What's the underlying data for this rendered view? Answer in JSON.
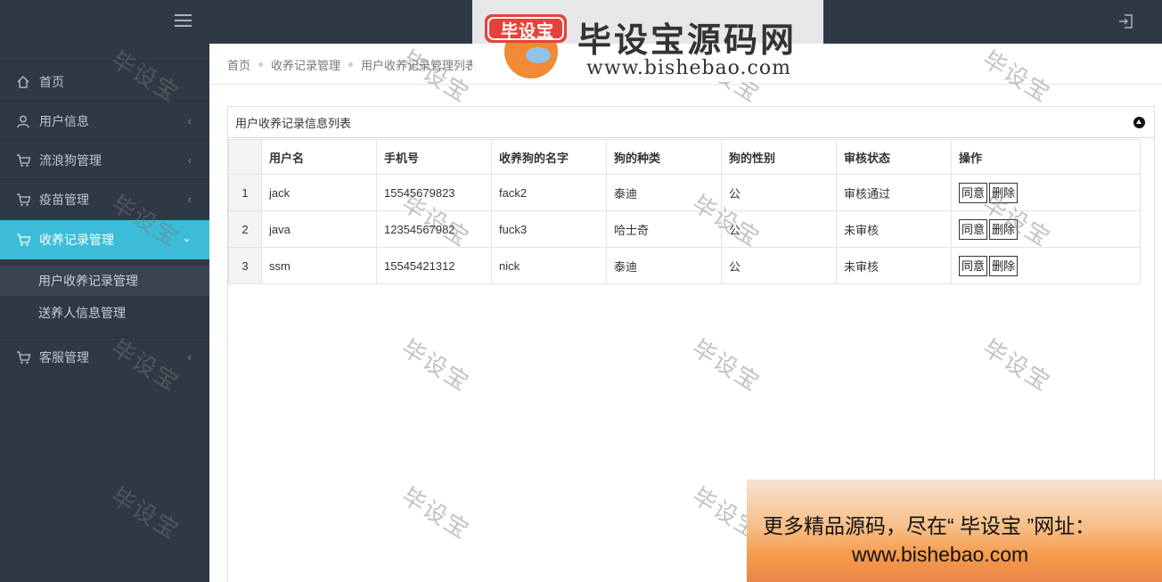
{
  "topbar": {
    "menu_icon": "hamburger-icon",
    "logout_icon": "logout-icon"
  },
  "sidebar": {
    "items": [
      {
        "label": "首页",
        "icon": "home-icon",
        "has_submenu": false
      },
      {
        "label": "用户信息",
        "icon": "user-icon",
        "has_submenu": true
      },
      {
        "label": "流浪狗管理",
        "icon": "cart-icon",
        "has_submenu": true
      },
      {
        "label": "疫苗管理",
        "icon": "cart-icon",
        "has_submenu": true
      },
      {
        "label": "收养记录管理",
        "icon": "cart-icon",
        "has_submenu": true,
        "expanded": true
      },
      {
        "label": "客服管理",
        "icon": "cart-icon",
        "has_submenu": true
      }
    ],
    "subitems": [
      {
        "label": "用户收养记录管理",
        "current": true
      },
      {
        "label": "送养人信息管理",
        "current": false
      }
    ],
    "active_color": "#3cbcd8"
  },
  "breadcrumb": {
    "items": [
      "首页",
      "收养记录管理",
      "用户收养记录管理列表"
    ]
  },
  "panel": {
    "title": "用户收养记录信息列表",
    "columns": [
      "用户名",
      "手机号",
      "收养狗的名字",
      "狗的种类",
      "狗的性别",
      "审核状态",
      "操作"
    ],
    "rows": [
      {
        "index": "1",
        "username": "jack",
        "phone": "15545679823",
        "dog_name": "fack2",
        "breed": "泰迪",
        "gender": "公",
        "status": "审核通过"
      },
      {
        "index": "2",
        "username": "java",
        "phone": "12354567982",
        "dog_name": "fuck3",
        "breed": "哈士奇",
        "gender": "公",
        "status": "未审核"
      },
      {
        "index": "3",
        "username": "ssm",
        "phone": "15545421312",
        "dog_name": "nick",
        "breed": "泰迪",
        "gender": "公",
        "status": "未审核"
      }
    ],
    "approve_label": "同意",
    "delete_label": "删除"
  },
  "watermark": {
    "text": "毕设宝"
  },
  "logo_banner": {
    "title": "毕设宝源码网",
    "badge": "毕设宝",
    "url": "www.bishebao.com"
  },
  "ad": {
    "line1": "更多精品源码，尽在“ 毕设宝 ”网址：",
    "line2": "www.bishebao.com"
  }
}
